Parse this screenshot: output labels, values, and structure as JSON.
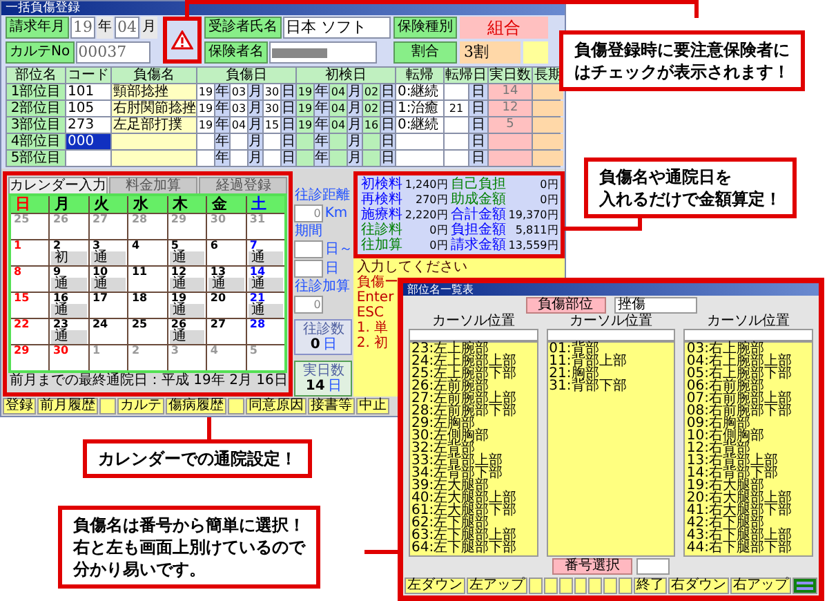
{
  "main_window": {
    "title": "一括負傷登録"
  },
  "header": {
    "billing_label": "請求年月",
    "billing_year": "19",
    "year_unit": "年",
    "billing_month": "04",
    "month_unit": "月",
    "chart_no_label": "カルテNo",
    "chart_no": "00037",
    "warning": true,
    "patient_label": "受診者氏名",
    "patient_name": "日本 ソフト",
    "insurer_label": "保険者名",
    "insurance_type_label": "保険種別",
    "insurance_type": "組合",
    "ratio_label": "割合",
    "ratio": "3割"
  },
  "injury_table": {
    "columns": [
      "部位名",
      "コード",
      "負傷名",
      "負傷日",
      "初検日",
      "転帰",
      "転帰日",
      "実日数",
      "長期"
    ],
    "rows": [
      {
        "part": "1部位目",
        "code": "101",
        "injury": "頸部捻挫",
        "injury_date": [
          {
            "value": "19",
            "unit": "年"
          },
          {
            "value": "03",
            "unit": "月"
          },
          {
            "value": "30",
            "unit": "日"
          }
        ],
        "first_visit": [
          {
            "value": "19",
            "unit": "年"
          },
          {
            "value": "04",
            "unit": "月"
          },
          {
            "value": "02",
            "unit": "日"
          }
        ],
        "outcome": "0:継続",
        "outcome_date": {
          "unit": "日"
        },
        "days": "14",
        "selected": false
      },
      {
        "part": "2部位目",
        "code": "105",
        "injury": "右肘関節捻挫",
        "injury_date": [
          {
            "value": "19",
            "unit": "年"
          },
          {
            "value": "03",
            "unit": "月"
          },
          {
            "value": "30",
            "unit": "日"
          }
        ],
        "first_visit": [
          {
            "value": "19",
            "unit": "年"
          },
          {
            "value": "04",
            "unit": "月"
          },
          {
            "value": "02",
            "unit": "日"
          }
        ],
        "outcome": "1:治癒",
        "outcome_date": {
          "value": "21",
          "unit": "日"
        },
        "days": "12",
        "selected": false
      },
      {
        "part": "3部位目",
        "code": "273",
        "injury": "左足部打撲",
        "injury_date": [
          {
            "value": "19",
            "unit": "年"
          },
          {
            "value": "04",
            "unit": "月"
          },
          {
            "value": "15",
            "unit": "日"
          }
        ],
        "first_visit": [
          {
            "value": "19",
            "unit": "年"
          },
          {
            "value": "04",
            "unit": "月"
          },
          {
            "value": "16",
            "unit": "日"
          }
        ],
        "outcome": "0:継続",
        "outcome_date": {
          "unit": "日"
        },
        "days": "5",
        "selected": false
      },
      {
        "part": "4部位目",
        "code": "000",
        "injury_date": [
          {
            "unit": "年"
          },
          {
            "unit": "月"
          },
          {
            "unit": "日"
          }
        ],
        "first_visit": [
          {
            "unit": "年"
          },
          {
            "unit": "月"
          },
          {
            "unit": "日"
          }
        ],
        "outcome_date": {
          "unit": "日"
        },
        "selected": true
      },
      {
        "part": "5部位目",
        "injury_date": [
          {
            "unit": "年"
          },
          {
            "unit": "月"
          },
          {
            "unit": "日"
          }
        ],
        "first_visit": [
          {
            "unit": "年"
          },
          {
            "unit": "月"
          },
          {
            "unit": "日"
          }
        ],
        "outcome_date": {
          "unit": "日"
        },
        "selected": false
      }
    ]
  },
  "calendar": {
    "tabs": [
      {
        "label": "カレンダー入力",
        "selected": true
      },
      {
        "label": "料金加算",
        "selected": false
      },
      {
        "label": "経過登録",
        "selected": false
      }
    ],
    "weekdays": [
      {
        "label": "日",
        "color": "#ff0000"
      },
      {
        "label": "月",
        "color": "#000000"
      },
      {
        "label": "火",
        "color": "#000000"
      },
      {
        "label": "水",
        "color": "#000000"
      },
      {
        "label": "木",
        "color": "#000000"
      },
      {
        "label": "金",
        "color": "#000000"
      },
      {
        "label": "土",
        "color": "#0000ff"
      }
    ],
    "weeks": [
      [
        {
          "day": "25",
          "color": "#999999"
        },
        {
          "day": "26",
          "color": "#999999"
        },
        {
          "day": "27",
          "color": "#999999"
        },
        {
          "day": "28",
          "color": "#999999"
        },
        {
          "day": "29",
          "color": "#999999"
        },
        {
          "day": "30",
          "color": "#999999"
        },
        {
          "day": "31",
          "color": "#999999"
        }
      ],
      [
        {
          "day": "1",
          "color": "#ff0000"
        },
        {
          "day": "2",
          "color": "#000000",
          "mark": "初"
        },
        {
          "day": "3",
          "color": "#000000",
          "mark": "通"
        },
        {
          "day": "4",
          "color": "#000000"
        },
        {
          "day": "5",
          "color": "#000000",
          "mark": "通"
        },
        {
          "day": "6",
          "color": "#000000"
        },
        {
          "day": "7",
          "color": "#0000ff",
          "mark": "通"
        }
      ],
      [
        {
          "day": "8",
          "color": "#ff0000"
        },
        {
          "day": "9",
          "color": "#000000",
          "mark": "通"
        },
        {
          "day": "10",
          "color": "#000000",
          "mark": "通"
        },
        {
          "day": "11",
          "color": "#000000"
        },
        {
          "day": "12",
          "color": "#000000",
          "mark": "通"
        },
        {
          "day": "13",
          "color": "#000000",
          "mark": "通"
        },
        {
          "day": "14",
          "color": "#0000ff",
          "mark": "通"
        }
      ],
      [
        {
          "day": "15",
          "color": "#ff0000"
        },
        {
          "day": "16",
          "color": "#000000",
          "mark": "通"
        },
        {
          "day": "17",
          "color": "#000000"
        },
        {
          "day": "18",
          "color": "#000000"
        },
        {
          "day": "19",
          "color": "#000000",
          "mark": "通"
        },
        {
          "day": "20",
          "color": "#000000"
        },
        {
          "day": "21",
          "color": "#0000ff",
          "mark": "通"
        }
      ],
      [
        {
          "day": "22",
          "color": "#ff0000"
        },
        {
          "day": "23",
          "color": "#000000",
          "mark": "通"
        },
        {
          "day": "24",
          "color": "#000000"
        },
        {
          "day": "25",
          "color": "#000000"
        },
        {
          "day": "26",
          "color": "#000000",
          "mark": "通"
        },
        {
          "day": "27",
          "color": "#000000"
        },
        {
          "day": "28",
          "color": "#0000ff"
        }
      ],
      [
        {
          "day": "29",
          "color": "#ff0000"
        },
        {
          "day": "30",
          "color": "#ff0000"
        },
        {
          "day": "1",
          "color": "#999999"
        },
        {
          "day": "2",
          "color": "#999999"
        },
        {
          "day": "3",
          "color": "#999999"
        },
        {
          "day": "4",
          "color": "#999999"
        },
        {
          "day": "5",
          "color": "#999999"
        }
      ]
    ],
    "footer": "前月までの最終通院日：平成 19年 2月 16日"
  },
  "visit_panel": {
    "distance_label": "往診距離",
    "distance": "0",
    "distance_unit": "Km",
    "period_label": "期間",
    "period_from_unit": "日～",
    "period_to_unit": "日",
    "visit_add_label": "往診加算",
    "visit_add": "0",
    "visits_label": "往診数",
    "visits": "0",
    "visits_unit": "日",
    "days_label": "実日数",
    "days": "14",
    "days_unit": "日"
  },
  "amounts": {
    "left": [
      {
        "label": "初検料",
        "color": "#0000ff",
        "amount": "1,240円"
      },
      {
        "label": "再検料",
        "color": "#0000ff",
        "amount": "270円"
      },
      {
        "label": "施療料",
        "color": "#0000ff",
        "amount": "2,220円"
      },
      {
        "label": "往診料",
        "color": "#008000",
        "amount": "0円"
      },
      {
        "label": "往加算",
        "color": "#008000",
        "amount": "0円"
      }
    ],
    "right": [
      {
        "label": "自己負担",
        "color": "#008000",
        "amount": "0円"
      },
      {
        "label": "助成金額",
        "color": "#008000",
        "amount": "0円"
      },
      {
        "label": "合計金額",
        "color": "#0000ff",
        "amount": "19,370円"
      },
      {
        "label": "負担金額",
        "color": "#0000ff",
        "amount": "5,811円"
      },
      {
        "label": "請求金額",
        "color": "#0000ff",
        "amount": "13,559円"
      }
    ]
  },
  "memo_lines": [
    "入力してください",
    "負傷ー",
    "Enter",
    "ESC",
    "1. 単",
    "2. 初"
  ],
  "main_buttons": [
    {
      "kind": "text",
      "label": "登録"
    },
    {
      "kind": "text",
      "label": "前月履歴"
    },
    {
      "kind": "blank"
    },
    {
      "kind": "text",
      "label": "カルテ"
    },
    {
      "kind": "text",
      "label": "傷病履歴"
    },
    {
      "kind": "blank"
    },
    {
      "kind": "text",
      "label": "同意原因"
    },
    {
      "kind": "text",
      "label": "接書等"
    },
    {
      "kind": "text",
      "label": "中止"
    }
  ],
  "dialog": {
    "title": "部位名一覧表",
    "part_button": "負傷部位",
    "injury_field": "挫傷",
    "columns": [
      {
        "header": "カーソル位置",
        "items": [
          "23:左上腕部",
          "24:左上腕部上部",
          "25:左上腕部下部",
          "26:左前腕部",
          "27:左前腕部上部",
          "28:左前腕部下部",
          "29:左胸部",
          "30:左側胸部",
          "32:左背部",
          "33:左背部上部",
          "34:左背部下部",
          "39:左大腿部",
          "40:左大腿部上部",
          "61:左大腿部下部",
          "62:左下腿部",
          "63:左下腿部上部",
          "64:左下腿部下部"
        ]
      },
      {
        "header": "カーソル位置",
        "items": [
          "01:背部",
          "11:背部上部",
          "21:胸部",
          "31:背部下部"
        ]
      },
      {
        "header": "カーソル位置",
        "items": [
          "03:右上腕部",
          "04:右上腕部上部",
          "05:右上腕部下部",
          "06:右前腕部",
          "07:右前腕部上部",
          "08:右前腕部下部",
          "09:右胸部",
          "10:右側胸部",
          "12:右背部",
          "13:右背部上部",
          "14:右背部下部",
          "19:右大腿部",
          "20:右大腿部上部",
          "41:右大腿部下部",
          "42:右下腿部",
          "43:右下腿部上部",
          "44:右下腿部下部"
        ]
      }
    ],
    "select_button": "番号選択",
    "buttons": [
      {
        "kind": "text",
        "label": "左ダウン"
      },
      {
        "kind": "text",
        "label": "左アップ"
      },
      {
        "kind": "blank"
      },
      {
        "kind": "blank"
      },
      {
        "kind": "blank"
      },
      {
        "kind": "blank"
      },
      {
        "kind": "blank"
      },
      {
        "kind": "blank"
      },
      {
        "kind": "blank"
      },
      {
        "kind": "text",
        "label": "終了"
      },
      {
        "kind": "text",
        "label": "右ダウン"
      },
      {
        "kind": "text",
        "label": "右アップ"
      },
      {
        "kind": "icon"
      }
    ]
  },
  "callouts": [
    [
      "負傷登録時に要注意保険者に",
      "はチェックが表示されます！"
    ],
    [
      "負傷名や通院日を",
      "入れるだけで金額算定！"
    ],
    [
      "カレンダーでの通院設定！"
    ],
    [
      "負傷名は番号から簡単に選択！",
      "右と左も画面上別けているので",
      "分かり易いです。"
    ]
  ]
}
